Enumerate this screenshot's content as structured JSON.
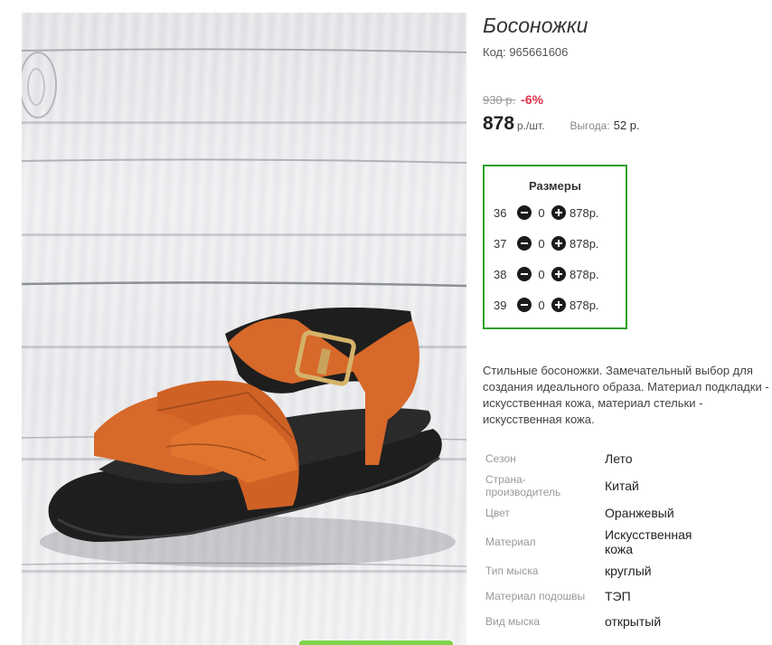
{
  "product": {
    "title": "Босоножки",
    "code": "Код: 965661606",
    "old_price": "930 р.",
    "discount": "-6%",
    "price": "878",
    "unit": "р./шт.",
    "benefit_label": "Выгода:",
    "benefit_value": "52 р."
  },
  "sizes": {
    "title": "Размеры",
    "items": [
      {
        "size": "36",
        "qty": "0",
        "price": "878р."
      },
      {
        "size": "37",
        "qty": "0",
        "price": "878р."
      },
      {
        "size": "38",
        "qty": "0",
        "price": "878р."
      },
      {
        "size": "39",
        "qty": "0",
        "price": "878р."
      }
    ]
  },
  "description": "Стильные босоножки. Замечательный выбор для создания идеального образа. Материал подкладки - искусственная кожа, материал стельки - искусственная кожа.",
  "specs": [
    {
      "label": "Сезон",
      "value": "Лето"
    },
    {
      "label": "Страна-производитель",
      "value": "Китай"
    },
    {
      "label": "Цвет",
      "value": "Оранжевый"
    },
    {
      "label": "Материал",
      "value": "Искусственная кожа"
    },
    {
      "label": "Тип мыска",
      "value": "круглый"
    },
    {
      "label": "Материал подошвы",
      "value": "ТЭП"
    },
    {
      "label": "Вид мыска",
      "value": "открытый"
    }
  ],
  "icons": {
    "minus": "minus-circle-icon",
    "plus": "plus-circle-icon"
  },
  "colors": {
    "sizes_border": "#2ea02a",
    "discount": "#e2324b",
    "sandal_leather": "#d7692a",
    "sole": "#1e1e1e"
  }
}
